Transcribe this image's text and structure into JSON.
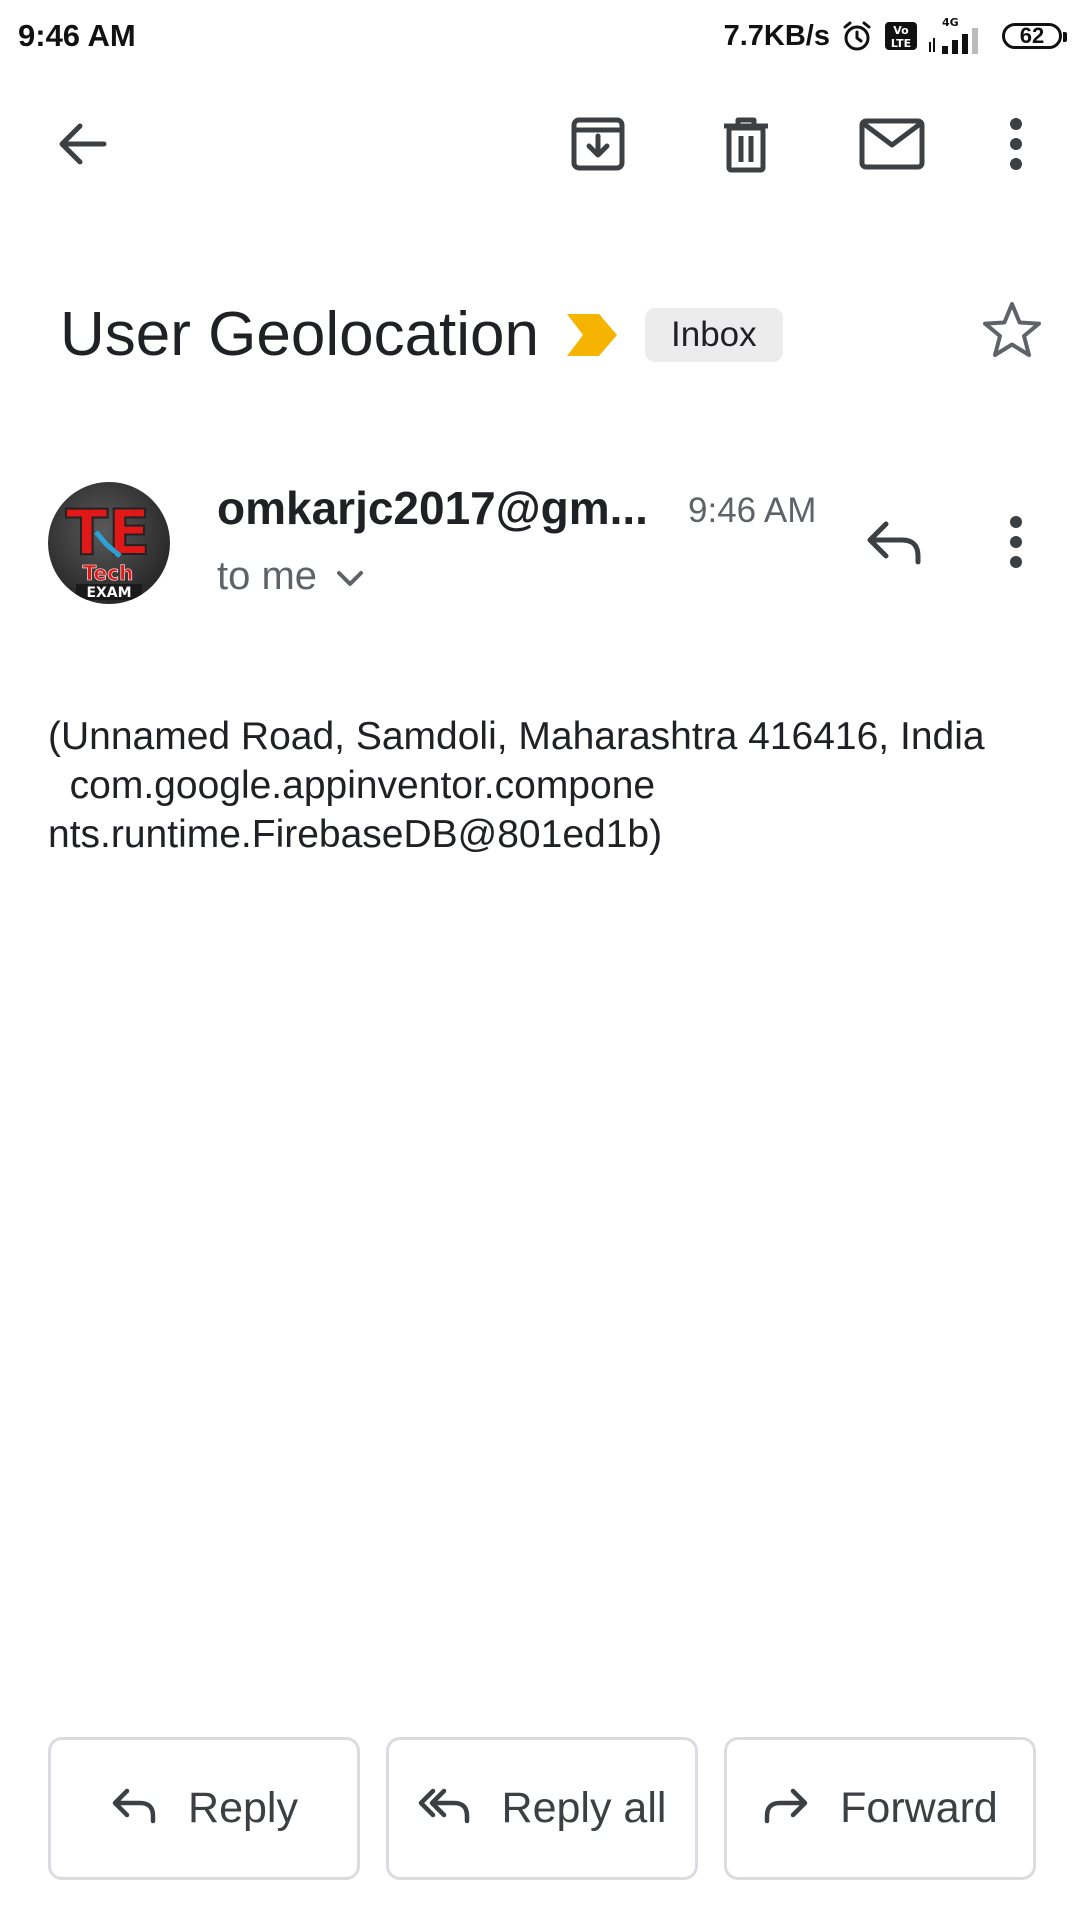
{
  "status_bar": {
    "time": "9:46 AM",
    "net_speed": "7.7KB/s",
    "volte_label": "Vo LTE",
    "network_type": "4G",
    "battery_level": "62",
    "icons": [
      "alarm-icon",
      "volte-icon",
      "signal-icon",
      "battery-icon"
    ]
  },
  "toolbar": {
    "icons": [
      "back-arrow-icon",
      "archive-icon",
      "delete-icon",
      "mark-unread-icon",
      "more-vert-icon"
    ]
  },
  "email": {
    "subject": "User Geolocation",
    "label": "Inbox",
    "importance_color": "#F4B400",
    "sender": "omkarjc2017@gm...",
    "time": "9:46 AM",
    "recipients": "to me",
    "body": "(Unnamed Road, Samdoli, Maharashtra 416416, India\n  com.google.appinventor.compone\nnts.runtime.FirebaseDB@801ed1b)"
  },
  "avatar": {
    "line1": "TE",
    "line2": "Tech",
    "line3": "EXAM"
  },
  "actions": {
    "reply": "Reply",
    "reply_all": "Reply all",
    "forward": "Forward"
  }
}
